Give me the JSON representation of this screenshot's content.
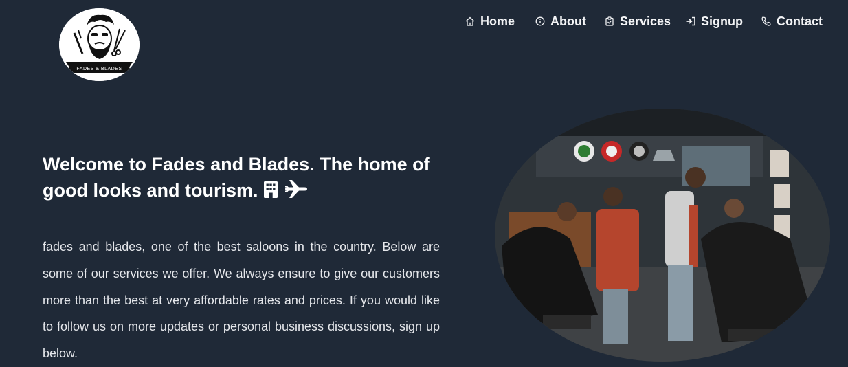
{
  "brand": {
    "logo_text": "FADES & BLADES"
  },
  "nav": {
    "items": [
      {
        "label": "Home",
        "icon": "home-icon"
      },
      {
        "label": "About",
        "icon": "info-icon"
      },
      {
        "label": "Services",
        "icon": "clipboard-check-icon"
      },
      {
        "label": "Signup",
        "icon": "sign-in-icon"
      },
      {
        "label": "Contact",
        "icon": "phone-icon"
      }
    ]
  },
  "hero": {
    "title": "Welcome to Fades and Blades. The home of good looks and tourism.",
    "title_icons": [
      "building-icon",
      "airplane-icon"
    ],
    "body": "fades and blades, one of the best saloons in the country. Below are some of our services we offer. We always ensure to give our customers more than the best at very affordable rates and prices. If you would like to follow us on more updates or personal business discussions, sign up below."
  },
  "colors": {
    "background": "#1f2937",
    "text": "#ffffff",
    "body_text": "#e5e7eb"
  }
}
